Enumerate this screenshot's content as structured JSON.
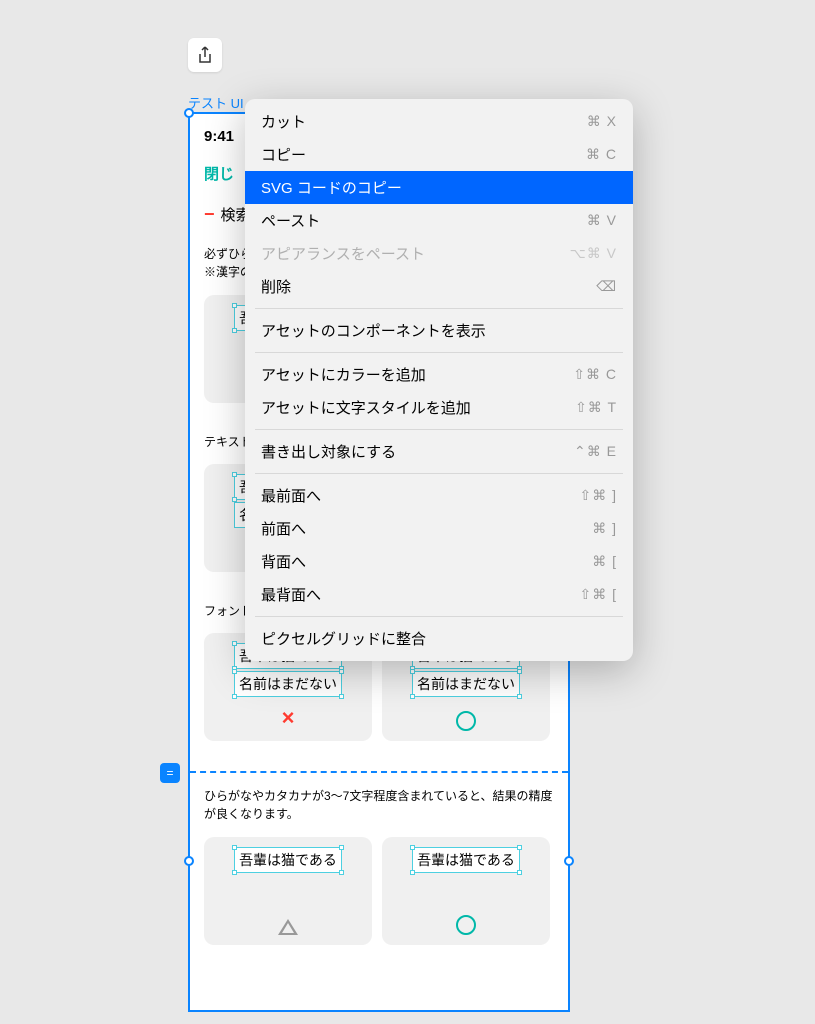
{
  "toolbar": {
    "tab_label": "テスト UI"
  },
  "artboard": {
    "time": "9:41",
    "close_label": "閉じ",
    "search_label": "検索",
    "hint1": "必ずひらがなかカタカナを含めてください",
    "hint2": "※漢字のみの検索はできません",
    "section_text": "テキスト",
    "section_font": "フォント",
    "sample_text1": "吾輩は猫である",
    "sample_text2": "名前はまだない",
    "bottom_hint": "ひらがなやカタカナが3〜7文字程度含まれていると、結果の精度が良くなります。"
  },
  "menu": {
    "items": [
      {
        "label": "カット",
        "shortcut": "⌘ X",
        "disabled": false
      },
      {
        "label": "コピー",
        "shortcut": "⌘ C",
        "disabled": false
      },
      {
        "label": "SVG コードのコピー",
        "shortcut": "",
        "disabled": false,
        "selected": true
      },
      {
        "label": "ペースト",
        "shortcut": "⌘ V",
        "disabled": false
      },
      {
        "label": "アピアランスをペースト",
        "shortcut": "⌥⌘ V",
        "disabled": true
      },
      {
        "label": "削除",
        "shortcut": "⌫",
        "disabled": false
      }
    ],
    "items2": [
      {
        "label": "アセットのコンポーネントを表示",
        "shortcut": "",
        "disabled": false
      }
    ],
    "items3": [
      {
        "label": "アセットにカラーを追加",
        "shortcut": "⇧⌘ C",
        "disabled": false
      },
      {
        "label": "アセットに文字スタイルを追加",
        "shortcut": "⇧⌘ T",
        "disabled": false
      }
    ],
    "items4": [
      {
        "label": "書き出し対象にする",
        "shortcut": "⌃⌘ E",
        "disabled": false
      }
    ],
    "items5": [
      {
        "label": "最前面へ",
        "shortcut": "⇧⌘ ]",
        "disabled": false
      },
      {
        "label": "前面へ",
        "shortcut": "⌘ ]",
        "disabled": false
      },
      {
        "label": "背面へ",
        "shortcut": "⌘ [",
        "disabled": false
      },
      {
        "label": "最背面へ",
        "shortcut": "⇧⌘ [",
        "disabled": false
      }
    ],
    "items6": [
      {
        "label": "ピクセルグリッドに整合",
        "shortcut": "",
        "disabled": false
      }
    ]
  }
}
